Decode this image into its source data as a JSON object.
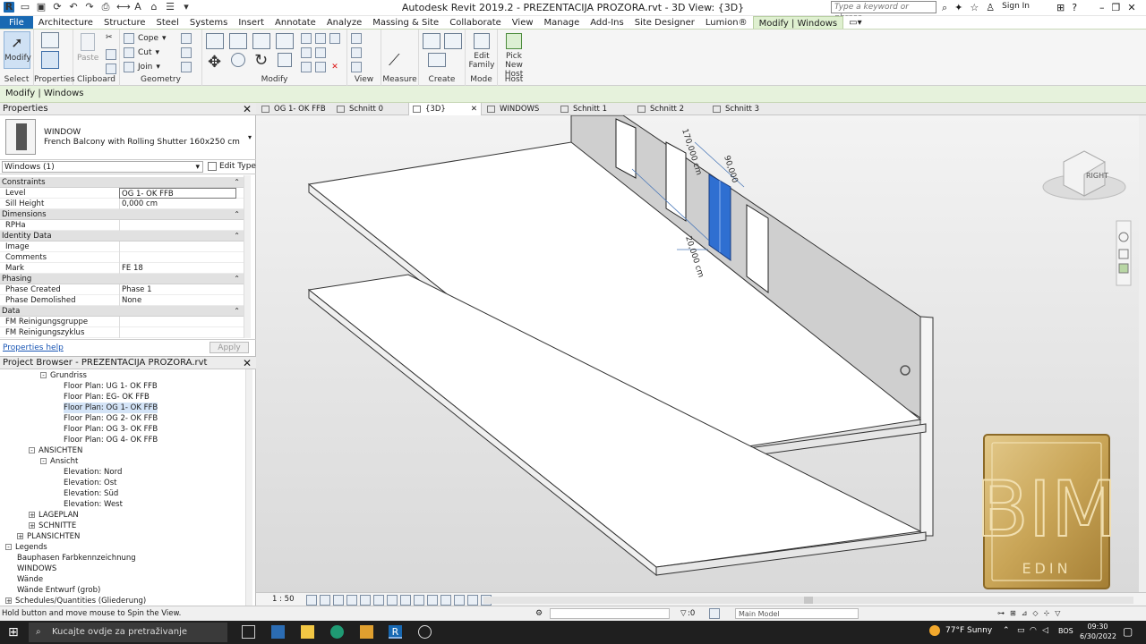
{
  "window": {
    "title": "Autodesk Revit 2019.2 - PREZENTACIJA PROZORA.rvt - 3D View: {3D}",
    "search_placeholder": "Type a keyword or phrase",
    "sign_in": "Sign In"
  },
  "ribbon_tabs": [
    "File",
    "Architecture",
    "Structure",
    "Steel",
    "Systems",
    "Insert",
    "Annotate",
    "Analyze",
    "Massing & Site",
    "Collaborate",
    "View",
    "Manage",
    "Add-Ins",
    "Site Designer",
    "Lumion®",
    "Modify | Windows"
  ],
  "ribbon": {
    "modify": "Modify",
    "paste": "Paste",
    "cope": "Cope",
    "cut": "Cut",
    "join": "Join",
    "edit_family": "Edit Family",
    "pick_new_host": "Pick New Host",
    "panels": [
      "Select",
      "Properties",
      "Clipboard",
      "Geometry",
      "Modify",
      "View",
      "Measure",
      "Create",
      "Mode",
      "Host"
    ]
  },
  "context_bar": "Modify | Windows",
  "properties": {
    "title": "Properties",
    "category": "WINDOW",
    "type_name": "French Balcony with Rolling Shutter 160x250 cm",
    "instance_selector": "Windows (1)",
    "edit_type": "Edit Type",
    "rows": [
      {
        "k": "Constraints",
        "group": true
      },
      {
        "k": "Level",
        "v": "OG 1- OK FFB"
      },
      {
        "k": "Sill Height",
        "v": "0,000 cm"
      },
      {
        "k": "Dimensions",
        "group": true
      },
      {
        "k": "RPHa",
        "v": ""
      },
      {
        "k": "Identity Data",
        "group": true
      },
      {
        "k": "Image",
        "v": ""
      },
      {
        "k": "Comments",
        "v": ""
      },
      {
        "k": "Mark",
        "v": "FE 18"
      },
      {
        "k": "Phasing",
        "group": true
      },
      {
        "k": "Phase Created",
        "v": "Phase 1"
      },
      {
        "k": "Phase Demolished",
        "v": "None"
      },
      {
        "k": "Data",
        "group": true
      },
      {
        "k": "FM Reinigungsgruppe",
        "v": ""
      },
      {
        "k": "FM Reinigungszyklus",
        "v": ""
      }
    ],
    "help": "Properties help",
    "apply": "Apply"
  },
  "browser": {
    "title": "Project Browser - PREZENTACIJA PROZORA.rvt",
    "nodes": [
      {
        "t": "Grundriss",
        "lvl": 3,
        "tog": "-"
      },
      {
        "t": "Floor Plan: UG 1- OK FFB",
        "lvl": 5
      },
      {
        "t": "Floor Plan: EG- OK FFB",
        "lvl": 5
      },
      {
        "t": "Floor Plan: OG 1- OK FFB",
        "lvl": 5,
        "sel": true
      },
      {
        "t": "Floor Plan: OG 2- OK FFB",
        "lvl": 5
      },
      {
        "t": "Floor Plan: OG 3- OK FFB",
        "lvl": 5
      },
      {
        "t": "Floor Plan: OG 4- OK FFB",
        "lvl": 5
      },
      {
        "t": "ANSICHTEN",
        "lvl": 2,
        "tog": "-"
      },
      {
        "t": "Ansicht",
        "lvl": 3,
        "tog": "-"
      },
      {
        "t": "Elevation: Nord",
        "lvl": 5
      },
      {
        "t": "Elevation: Ost",
        "lvl": 5
      },
      {
        "t": "Elevation: Süd",
        "lvl": 5
      },
      {
        "t": "Elevation: West",
        "lvl": 5
      },
      {
        "t": "LAGEPLAN",
        "lvl": 2,
        "tog": "+"
      },
      {
        "t": "SCHNITTE",
        "lvl": 2,
        "tog": "+"
      },
      {
        "t": "PLANSICHTEN",
        "lvl": 1,
        "tog": "+"
      },
      {
        "t": "Legends",
        "lvl": 0,
        "tog": "-"
      },
      {
        "t": "Bauphasen Farbkennzeichnung",
        "lvl": 1
      },
      {
        "t": "WINDOWS",
        "lvl": 1
      },
      {
        "t": "Wände",
        "lvl": 1
      },
      {
        "t": "Wände Entwurf (grob)",
        "lvl": 1
      },
      {
        "t": "Schedules/Quantities (Gliederung)",
        "lvl": 0,
        "tog": "+"
      }
    ]
  },
  "view_tabs": [
    "OG 1- OK FFB",
    "Schnitt 0",
    "{3D}",
    "WINDOWS",
    "Schnitt 1",
    "Schnitt 2",
    "Schnitt 3"
  ],
  "viewport": {
    "dim_labels": [
      "170,000 cm",
      "90,000",
      "20,000 cm"
    ],
    "viewcube_label": "RIGHT",
    "logo_text": "BIM",
    "logo_sub": "EDIN"
  },
  "view_scale": "1 : 50",
  "status": {
    "message": "Hold button and move mouse to Spin the View.",
    "selection_count": ":0",
    "model": "Main Model"
  },
  "taskbar": {
    "search": "Kucajte ovdje za pretraživanje",
    "weather": "77°F Sunny",
    "lang": "BOS",
    "time": "09:30",
    "date": "6/30/2022"
  }
}
